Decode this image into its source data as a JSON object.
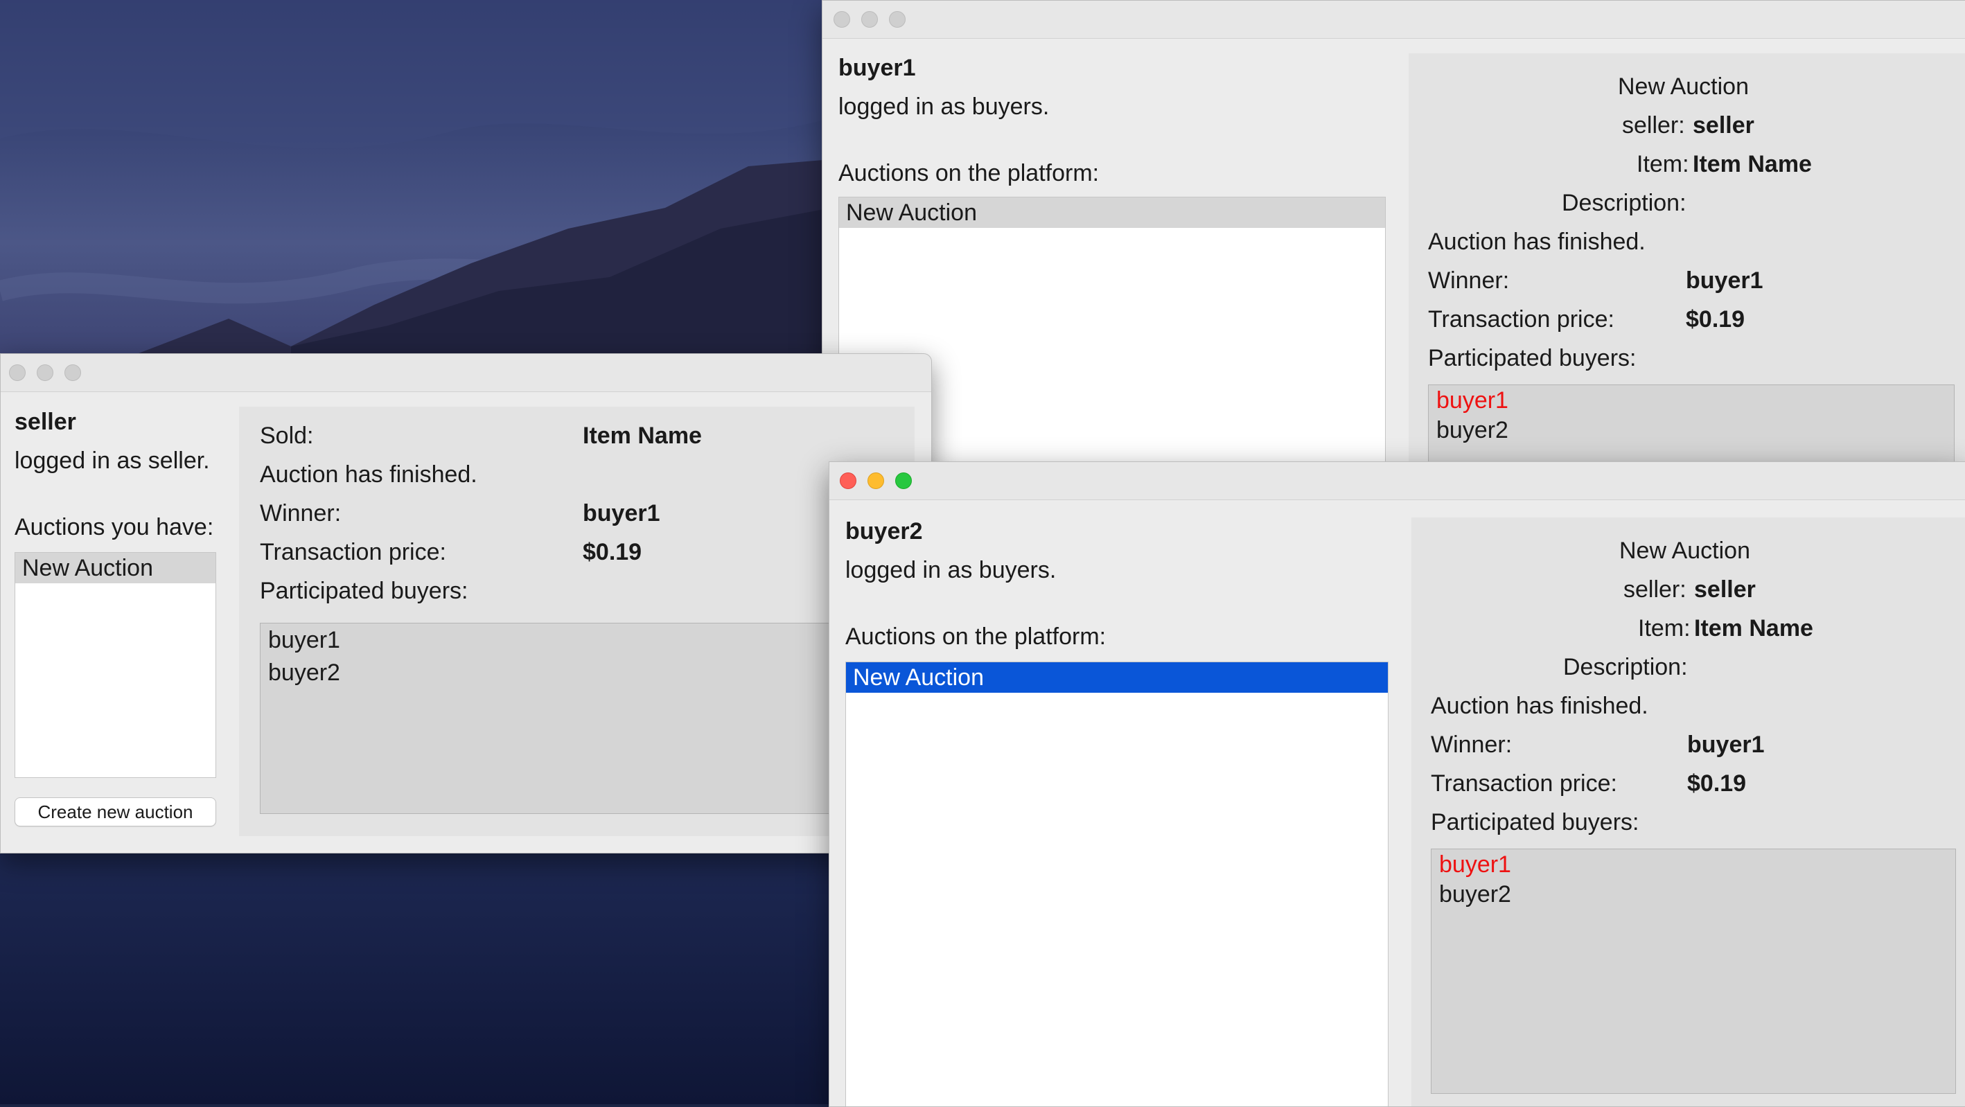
{
  "buyer1_window": {
    "username": "buyer1",
    "role_text": "logged in as buyers.",
    "auctions_heading": "Auctions on the platform:",
    "auctions": [
      "New Auction"
    ],
    "detail": {
      "auction_title": "New Auction",
      "seller_label": "seller:",
      "seller_value": "seller",
      "item_label": "Item:",
      "item_value": "Item Name",
      "description_label": "Description:",
      "status": "Auction has finished.",
      "winner_label": "Winner:",
      "winner_value": "buyer1",
      "price_label": "Transaction price:",
      "price_value": "$0.19",
      "participants_label": "Participated buyers:",
      "participants": [
        "buyer1",
        "buyer2"
      ]
    }
  },
  "seller_window": {
    "username": "seller",
    "role_text": "logged in as seller.",
    "auctions_heading": "Auctions you have:",
    "auctions": [
      "New Auction"
    ],
    "create_button": "Create new auction",
    "detail": {
      "sold_label": "Sold:",
      "sold_value": "Item Name",
      "status": "Auction has finished.",
      "winner_label": "Winner:",
      "winner_value": "buyer1",
      "price_label": "Transaction price:",
      "price_value": "$0.19",
      "participants_label": "Participated buyers:",
      "participants": [
        "buyer1",
        "buyer2"
      ]
    }
  },
  "buyer2_window": {
    "username": "buyer2",
    "role_text": "logged in as buyers.",
    "auctions_heading": "Auctions on the platform:",
    "auctions": [
      "New Auction"
    ],
    "detail": {
      "auction_title": "New Auction",
      "seller_label": "seller:",
      "seller_value": "seller",
      "item_label": "Item:",
      "item_value": "Item Name",
      "description_label": "Description:",
      "status": "Auction has finished.",
      "winner_label": "Winner:",
      "winner_value": "buyer1",
      "price_label": "Transaction price:",
      "price_value": "$0.19",
      "participants_label": "Participated buyers:",
      "participants": [
        "buyer1",
        "buyer2"
      ]
    }
  },
  "colors": {
    "winner_highlight": "#ee1111",
    "selection_blue": "#0a56d8",
    "selection_gray": "#d6d6d6"
  }
}
